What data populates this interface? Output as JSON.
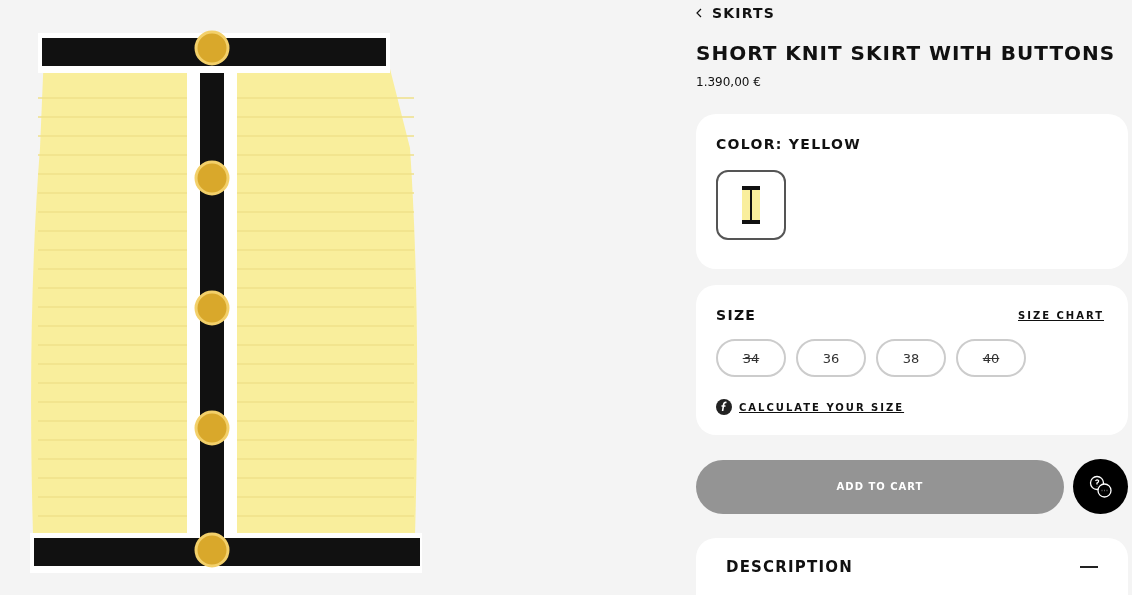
{
  "breadcrumb": {
    "label": "SKIRTS"
  },
  "product": {
    "title": "SHORT KNIT SKIRT WITH BUTTONS",
    "price": "1.390,00 €"
  },
  "color": {
    "label": "COLOR: YELLOW",
    "swatches": [
      {
        "selected": true
      }
    ]
  },
  "size": {
    "label": "SIZE",
    "chart_link": "SIZE CHART",
    "calculator_link": "CALCULATE YOUR SIZE",
    "options": [
      {
        "label": "34",
        "available": false
      },
      {
        "label": "36",
        "available": true
      },
      {
        "label": "38",
        "available": true
      },
      {
        "label": "40",
        "available": false
      }
    ]
  },
  "add_to_cart": {
    "label": "ADD TO CART",
    "disabled": true
  },
  "description": {
    "label": "DESCRIPTION",
    "expanded": true
  }
}
